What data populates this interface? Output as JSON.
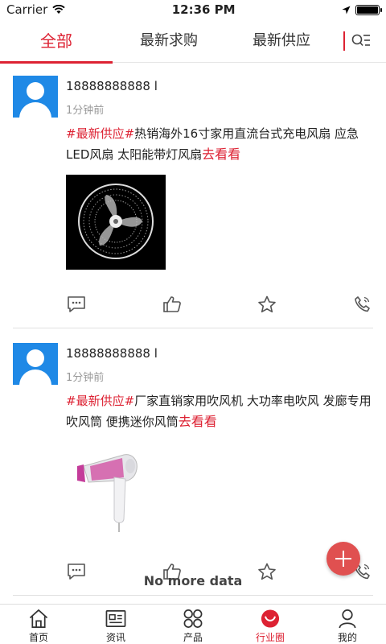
{
  "status": {
    "carrier": "Carrier",
    "time": "12:36 PM"
  },
  "tabs": [
    {
      "label": "全部"
    },
    {
      "label": "最新求购"
    },
    {
      "label": "最新供应"
    }
  ],
  "posts": [
    {
      "user": "18888888888 l",
      "time": "1分钟前",
      "tag": "#最新供应#",
      "text": "热销海外16寸家用直流台式充电风扇 应急LED风扇 太阳能带灯风扇",
      "more": "去看看",
      "image": "electric fan"
    },
    {
      "user": "18888888888 l",
      "time": "1分钟前",
      "tag": "#最新供应#",
      "text": "厂家直销家用吹风机 大功率电吹风 发廊专用吹风筒 便携迷你风筒",
      "more": "去看看",
      "image": "hair dryer"
    }
  ],
  "footer": {
    "no_more": "No more data"
  },
  "nav": [
    {
      "label": "首页",
      "icon": "home-icon"
    },
    {
      "label": "资讯",
      "icon": "news-icon"
    },
    {
      "label": "产品",
      "icon": "products-icon"
    },
    {
      "label": "行业圈",
      "icon": "industry-circle-icon"
    },
    {
      "label": "我的",
      "icon": "user-icon"
    }
  ],
  "colors": {
    "accent": "#dd2233",
    "avatar": "#1f89e6"
  }
}
